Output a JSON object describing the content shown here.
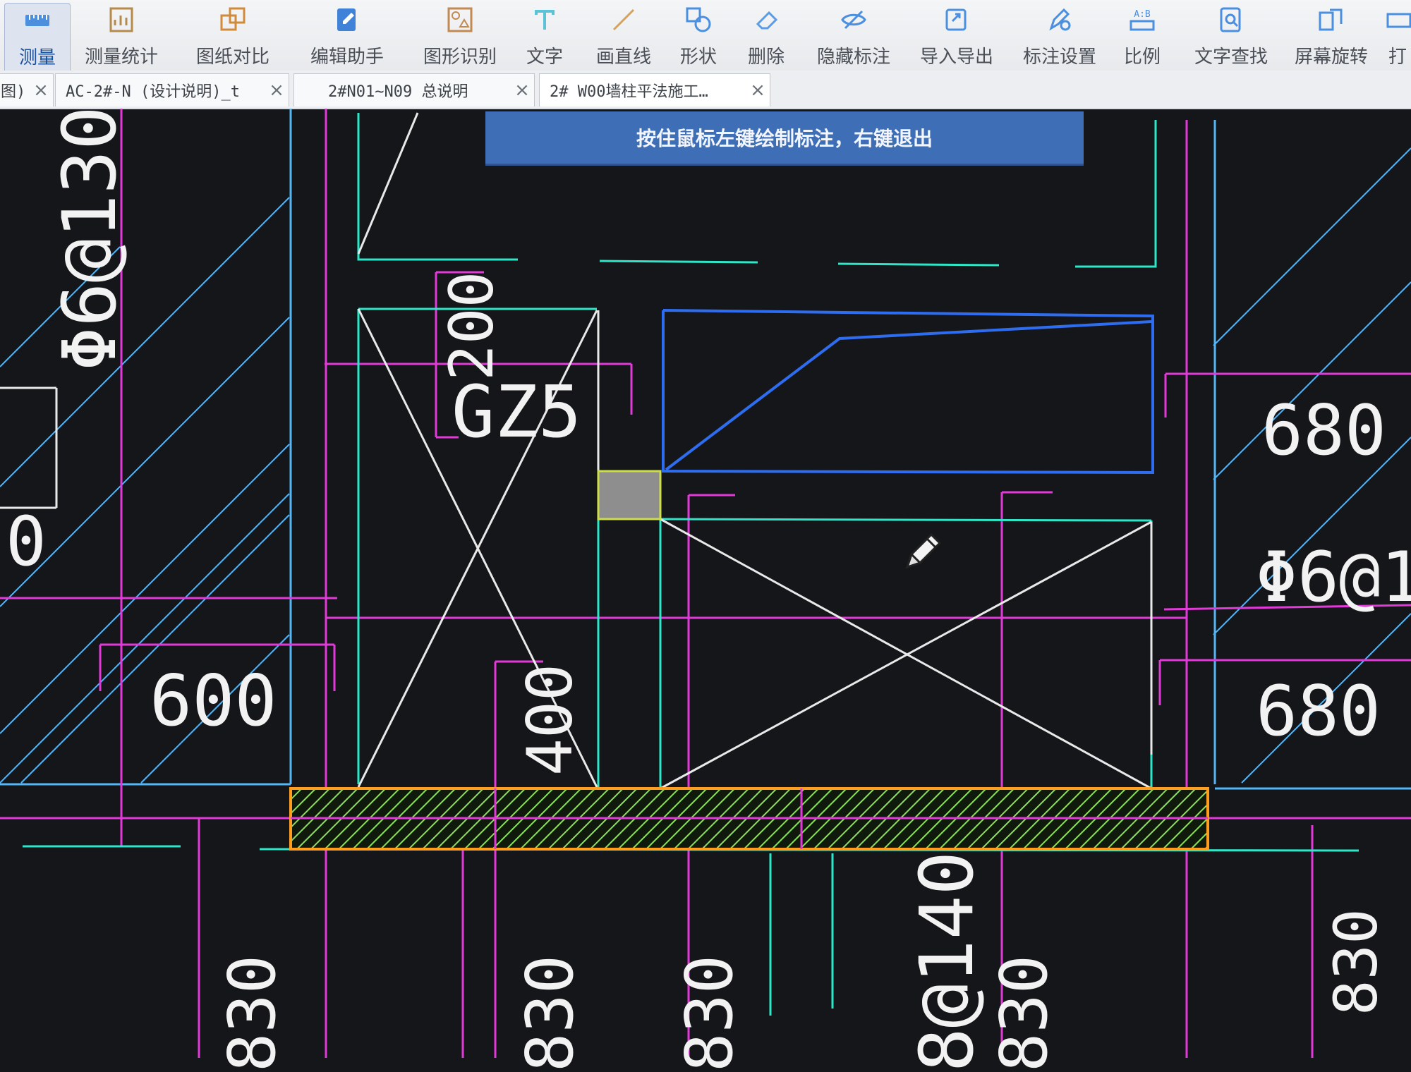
{
  "toolbar": {
    "items": [
      {
        "label": "测量",
        "icon": "ruler-icon"
      },
      {
        "label": "测量统计",
        "icon": "measure-stats-icon"
      },
      {
        "label": "图纸对比",
        "icon": "compare-icon"
      },
      {
        "label": "编辑助手",
        "icon": "edit-assistant-icon"
      },
      {
        "label": "图形识别",
        "icon": "shape-recognition-icon"
      },
      {
        "label": "文字",
        "icon": "text-icon"
      },
      {
        "label": "画直线",
        "icon": "line-icon"
      },
      {
        "label": "形状",
        "icon": "shape-icon"
      },
      {
        "label": "删除",
        "icon": "eraser-icon"
      },
      {
        "label": "隐藏标注",
        "icon": "eye-off-icon"
      },
      {
        "label": "导入导出",
        "icon": "import-export-icon"
      },
      {
        "label": "标注设置",
        "icon": "annotation-settings-icon"
      },
      {
        "label": "比例",
        "icon": "scale-icon"
      },
      {
        "label": "文字查找",
        "icon": "text-search-icon"
      },
      {
        "label": "屏幕旋转",
        "icon": "rotate-icon"
      },
      {
        "label": "打",
        "icon": "print-icon"
      }
    ],
    "active_index": 0
  },
  "tabs": [
    {
      "title": "图)",
      "close": "×"
    },
    {
      "title": "AC-2#-N (设计说明)_t",
      "close": "×"
    },
    {
      "title": "2#N01~N09 总说明",
      "close": "×"
    },
    {
      "title": "2# W00墙柱平法施工…",
      "close": "×"
    }
  ],
  "hint": "按住鼠标左键绘制标注，右键退出",
  "drawing": {
    "labels": {
      "rebar_left": "Φ6@130",
      "dim_left_partial": "0",
      "dim_600": "600",
      "gz_label": "GZ5",
      "dim_200": "200",
      "dim_400": "400",
      "dim_680_top": "680",
      "rebar_right": "Φ6@1",
      "dim_680_bottom": "680",
      "dim_830_1": "830",
      "dim_830_2": "830",
      "dim_830_3": "830",
      "rebar_bottom": "8@140",
      "dim_830_4": "830",
      "dim_830_5": "830"
    },
    "colors": {
      "background": "#141619",
      "magenta": "#e23ad9",
      "cyan": "#2fe6c8",
      "blue": "#2f6df0",
      "light_blue": "#55b6f5",
      "white": "#e9e9e9",
      "orange": "#ff9d1e",
      "green": "#8ce05a"
    }
  }
}
